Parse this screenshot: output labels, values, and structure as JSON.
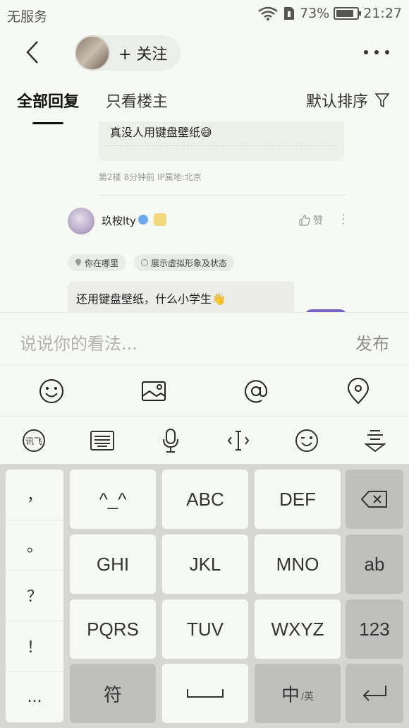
{
  "status_bar": {
    "carrier": "无服务",
    "battery": "73%",
    "time": "21:27"
  },
  "header": {
    "follow_label": "+ 关注"
  },
  "tabs": {
    "all": "全部回复",
    "owner_only": "只看楼主",
    "sort": "默认排序"
  },
  "thread": {
    "quote_text": "真没人用键盘壁纸😅",
    "floor_meta": "第2楼  8分钟前  IP属地:北京",
    "reply_user": "玖桉lty",
    "like_label": "赞",
    "chip_location": "你在哪里",
    "chip_avatar": "展示虚拟形象及状态",
    "draft_text": "还用键盘壁纸，什么小学生👋"
  },
  "comment": {
    "placeholder": "说说你的看法...",
    "publish": "发布"
  },
  "keyboard": {
    "punctuation": [
      "，",
      "。",
      "？",
      "！",
      "..."
    ],
    "keys": {
      "k_face": "^_^",
      "k_abc": "ABC",
      "k_def": "DEF",
      "k_ghi": "GHI",
      "k_jkl": "JKL",
      "k_mno": "MNO",
      "k_ab": "ab",
      "k_pqrs": "PQRS",
      "k_tuv": "TUV",
      "k_wxyz": "WXYZ",
      "k_123": "123",
      "k_symbol": "符",
      "k_lang_main": "中",
      "k_lang_sub": "/英"
    }
  }
}
